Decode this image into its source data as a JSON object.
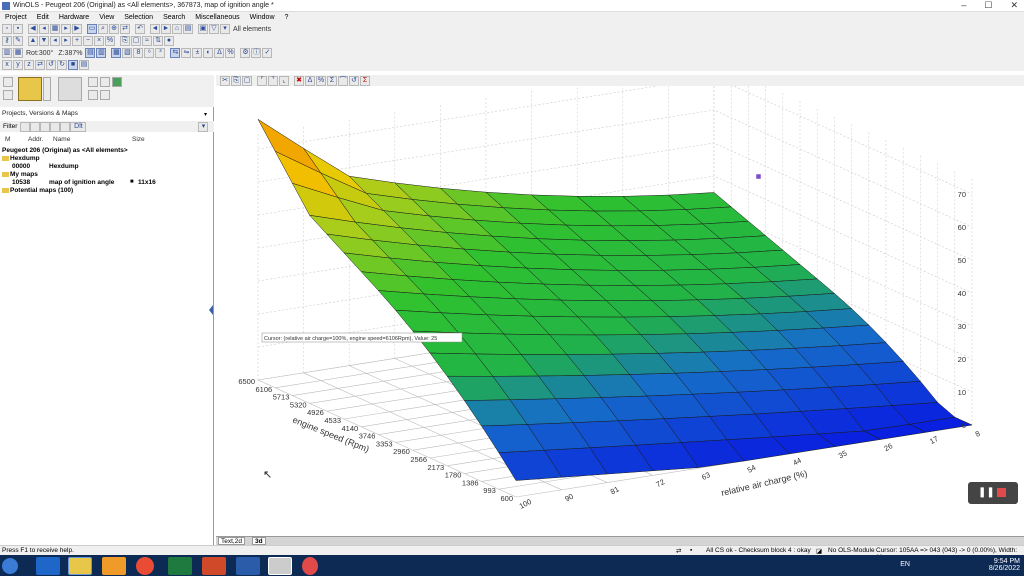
{
  "window": {
    "title": "WinOLS - Peugeot 206 (Original) as <All elements>, 367873, map of ignition angle *",
    "controls": [
      "–",
      "☐",
      "✕"
    ]
  },
  "menu": [
    "Project",
    "Edit",
    "Hardware",
    "View",
    "Selection",
    "Search",
    "Miscellaneous",
    "Window",
    "?"
  ],
  "toolbar": {
    "all_elements": "All elements",
    "rot_label": "Rot:300°",
    "zoom_label": "Z:387%"
  },
  "left": {
    "projects_header": "Projects, Versions & Maps",
    "filter_label": "Filter",
    "filter_btn": "Dlt",
    "columns": {
      "m": "M",
      "addr": "Addr.",
      "name": "Name",
      "size": "Size"
    },
    "tree": {
      "project": "Peugeot 206 (Original) as <All elements>",
      "hexdump_folder": "Hexdump",
      "hexdump_addr": "00000",
      "hexdump_name": "Hexdump",
      "mymaps_folder": "My maps",
      "map_addr": "10538",
      "map_name": "map of ignition angle",
      "map_size": "11x16",
      "potential": "Potential maps (100)"
    }
  },
  "chart": {
    "tooltip": "Cursor: (relative air charge=100%, engine speed=6106Rpm), Value: 25",
    "axis_z_ticks": [
      "70",
      "60",
      "50",
      "40",
      "30",
      "20",
      "10",
      "0"
    ],
    "axis_rpm_label": "engine speed (Rpm)",
    "axis_rpm_ticks": [
      "6500",
      "6106",
      "5713",
      "5320",
      "4926",
      "4533",
      "4140",
      "3746",
      "3353",
      "2960",
      "2566",
      "2173",
      "1780",
      "1386",
      "993",
      "600"
    ],
    "axis_air_label": "relative air charge (%)",
    "axis_air_ticks": [
      "100",
      "90",
      "81",
      "72",
      "63",
      "54",
      "44",
      "35",
      "26",
      "17",
      "8"
    ]
  },
  "tabs": {
    "tab1": "Text,2d",
    "tab2": "3d"
  },
  "status": {
    "left": "Press F1 to receive help.",
    "checksum": "All CS ok - Checksum block 4 : okay",
    "module": "No OLS-Module",
    "cursor": "Cursor: 105AA => 043 (043) -> 0 (0.00%), Width: 11"
  },
  "tray": {
    "lang": "EN",
    "time": "9:54 PM",
    "date": "8/26/2022"
  },
  "colors": {
    "surface_high": "#f2b600",
    "surface_mid": "#2fc12f",
    "surface_low": "#0a20e0"
  }
}
